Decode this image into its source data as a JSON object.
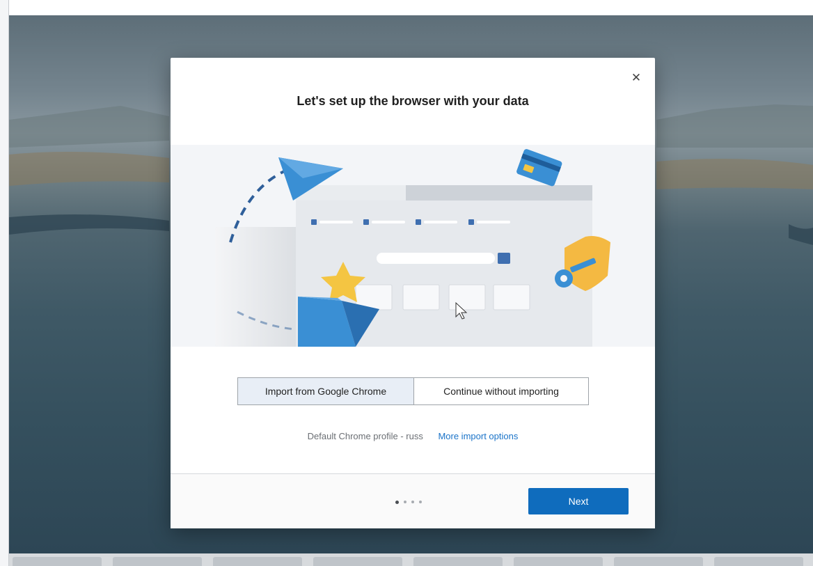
{
  "dialog": {
    "title": "Let's set up the browser with your data",
    "close_icon": "close-icon",
    "import_option": "Import from Google Chrome",
    "skip_option": "Continue without importing",
    "selected_option": "Import from Google Chrome",
    "profile_label": "Default Chrome profile - russ",
    "more_options_link": "More import options",
    "next_label": "Next",
    "step_current": 1,
    "step_total": 4
  },
  "colors": {
    "accent": "#0f6cbd",
    "link": "#1a73c8",
    "selected_option_bg": "#e8eef6"
  },
  "illustration_icons": [
    "paper-plane-icon",
    "credit-card-icon",
    "shield-key-icon",
    "star-folder-icon",
    "browser-window-icon",
    "cursor-icon"
  ]
}
